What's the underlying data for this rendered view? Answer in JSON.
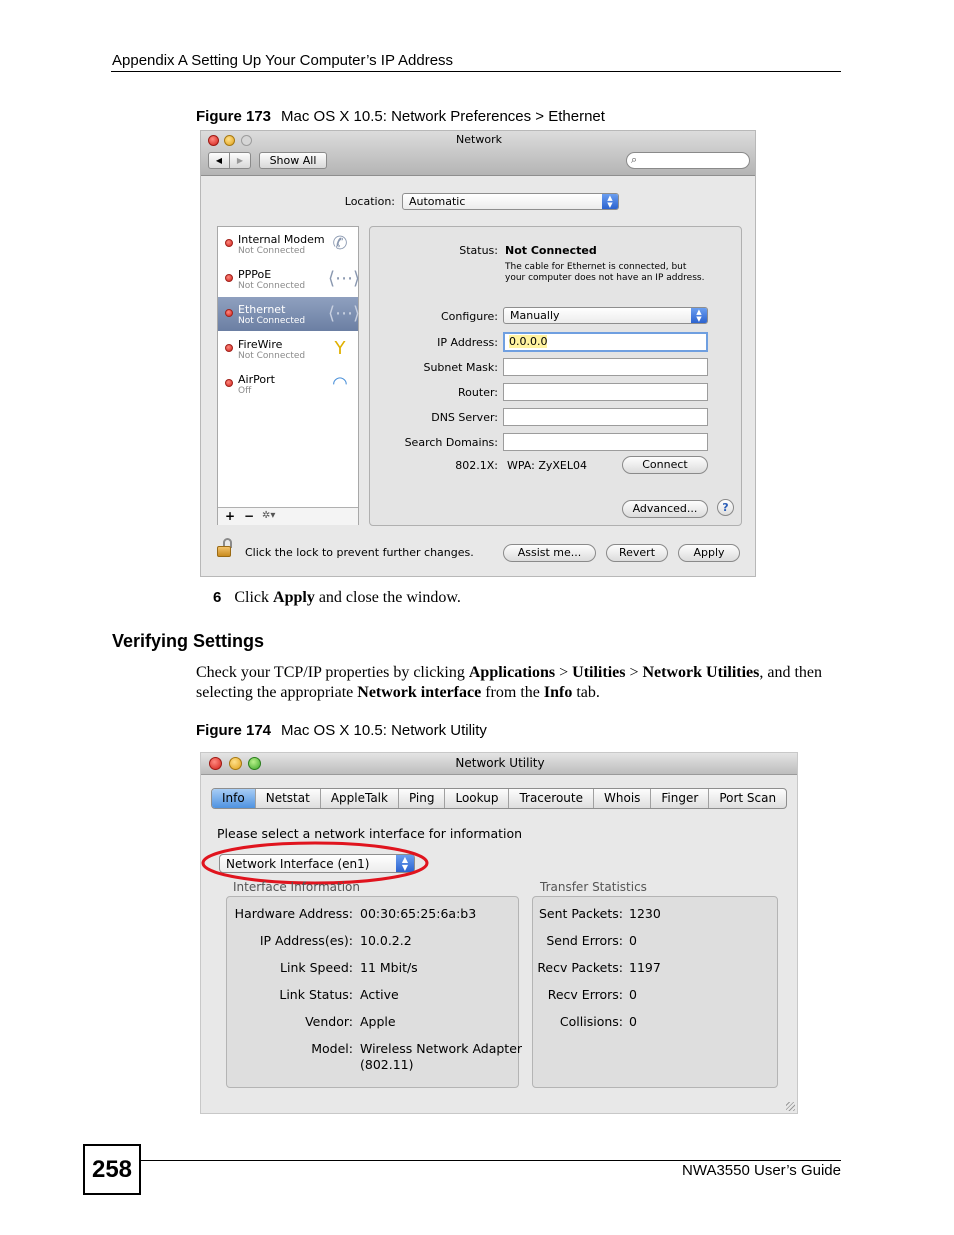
{
  "page_header": "Appendix A Setting Up Your Computer’s IP Address",
  "figure173": {
    "label": "Figure 173",
    "caption": "Mac OS X 10.5: Network Preferences > Ethernet",
    "window_title": "Network",
    "nav_back": "◀",
    "nav_forward": "▶",
    "show_all": "Show All",
    "search_placeholder": "",
    "location_label": "Location:",
    "location_value": "Automatic",
    "services": [
      {
        "name": "Internal Modem",
        "status": "Not Connected",
        "icon": "phone-icon"
      },
      {
        "name": "PPPoE",
        "status": "Not Connected",
        "icon": "pppoe-arrows-icon"
      },
      {
        "name": "Ethernet",
        "status": "Not Connected",
        "icon": "ethernet-arrows-icon"
      },
      {
        "name": "FireWire",
        "status": "Not Connected",
        "icon": "firewire-icon"
      },
      {
        "name": "AirPort",
        "status": "Off",
        "icon": "wifi-icon"
      }
    ],
    "list_add": "+",
    "list_remove": "−",
    "list_action": "✲▾",
    "status_label": "Status:",
    "status_value": "Not Connected",
    "status_desc_1": "The cable for Ethernet is connected, but",
    "status_desc_2": "your computer does not have an IP address.",
    "configure_label": "Configure:",
    "configure_value": "Manually",
    "ip_label": "IP Address:",
    "ip_value": "0.0.0.0",
    "subnet_label": "Subnet Mask:",
    "subnet_value": "",
    "router_label": "Router:",
    "router_value": "",
    "dns_label": "DNS Server:",
    "dns_value": "",
    "search_domains_label": "Search Domains:",
    "search_domains_value": "",
    "dot1x_label": "802.1X:",
    "dot1x_value": "WPA: ZyXEL04",
    "connect": "Connect",
    "advanced": "Advanced...",
    "help": "?",
    "lock_text": "Click the lock to prevent further changes.",
    "assist": "Assist me...",
    "revert": "Revert",
    "apply": "Apply"
  },
  "step6": {
    "number": "6",
    "pre": "Click ",
    "bold": "Apply",
    "post": " and close the window."
  },
  "section_title": "Verifying Settings",
  "paragraph": {
    "t1": "Check your TCP/IP properties by clicking ",
    "b1": "Applications",
    "t2": " > ",
    "b2": "Utilities",
    "t3": " > ",
    "b3": "Network Utilities",
    "t4": ", and then selecting the appropriate ",
    "b4": "Network interface",
    "t5": " from the ",
    "b5": "Info",
    "t6": " tab."
  },
  "figure174": {
    "label": "Figure 174",
    "caption": "Mac OS X 10.5: Network Utility",
    "window_title": "Network Utility",
    "tabs": [
      "Info",
      "Netstat",
      "AppleTalk",
      "Ping",
      "Lookup",
      "Traceroute",
      "Whois",
      "Finger",
      "Port Scan"
    ],
    "select_prompt": "Please select a network interface for information",
    "interface_value": "Network Interface (en1)",
    "interface_group_label": "Interface Information",
    "transfer_group_label": "Transfer Statistics",
    "interface_info": [
      {
        "k": "Hardware Address:",
        "v": "00:30:65:25:6a:b3"
      },
      {
        "k": "IP Address(es):",
        "v": "10.0.2.2"
      },
      {
        "k": "Link Speed:",
        "v": "11 Mbit/s"
      },
      {
        "k": "Link Status:",
        "v": "Active"
      },
      {
        "k": "Vendor:",
        "v": "Apple"
      },
      {
        "k": "Model:",
        "v": "Wireless Network Adapter"
      }
    ],
    "model_line2": "(802.11)",
    "transfer_stats": [
      {
        "k": "Sent Packets:",
        "v": "1230"
      },
      {
        "k": "Send Errors:",
        "v": "0"
      },
      {
        "k": "Recv Packets:",
        "v": "1197"
      },
      {
        "k": "Recv Errors:",
        "v": "0"
      },
      {
        "k": "Collisions:",
        "v": "0"
      }
    ],
    "highlight_color": "#e0141e"
  },
  "footer": {
    "page_number": "258",
    "guide": "NWA3550 User’s Guide"
  }
}
